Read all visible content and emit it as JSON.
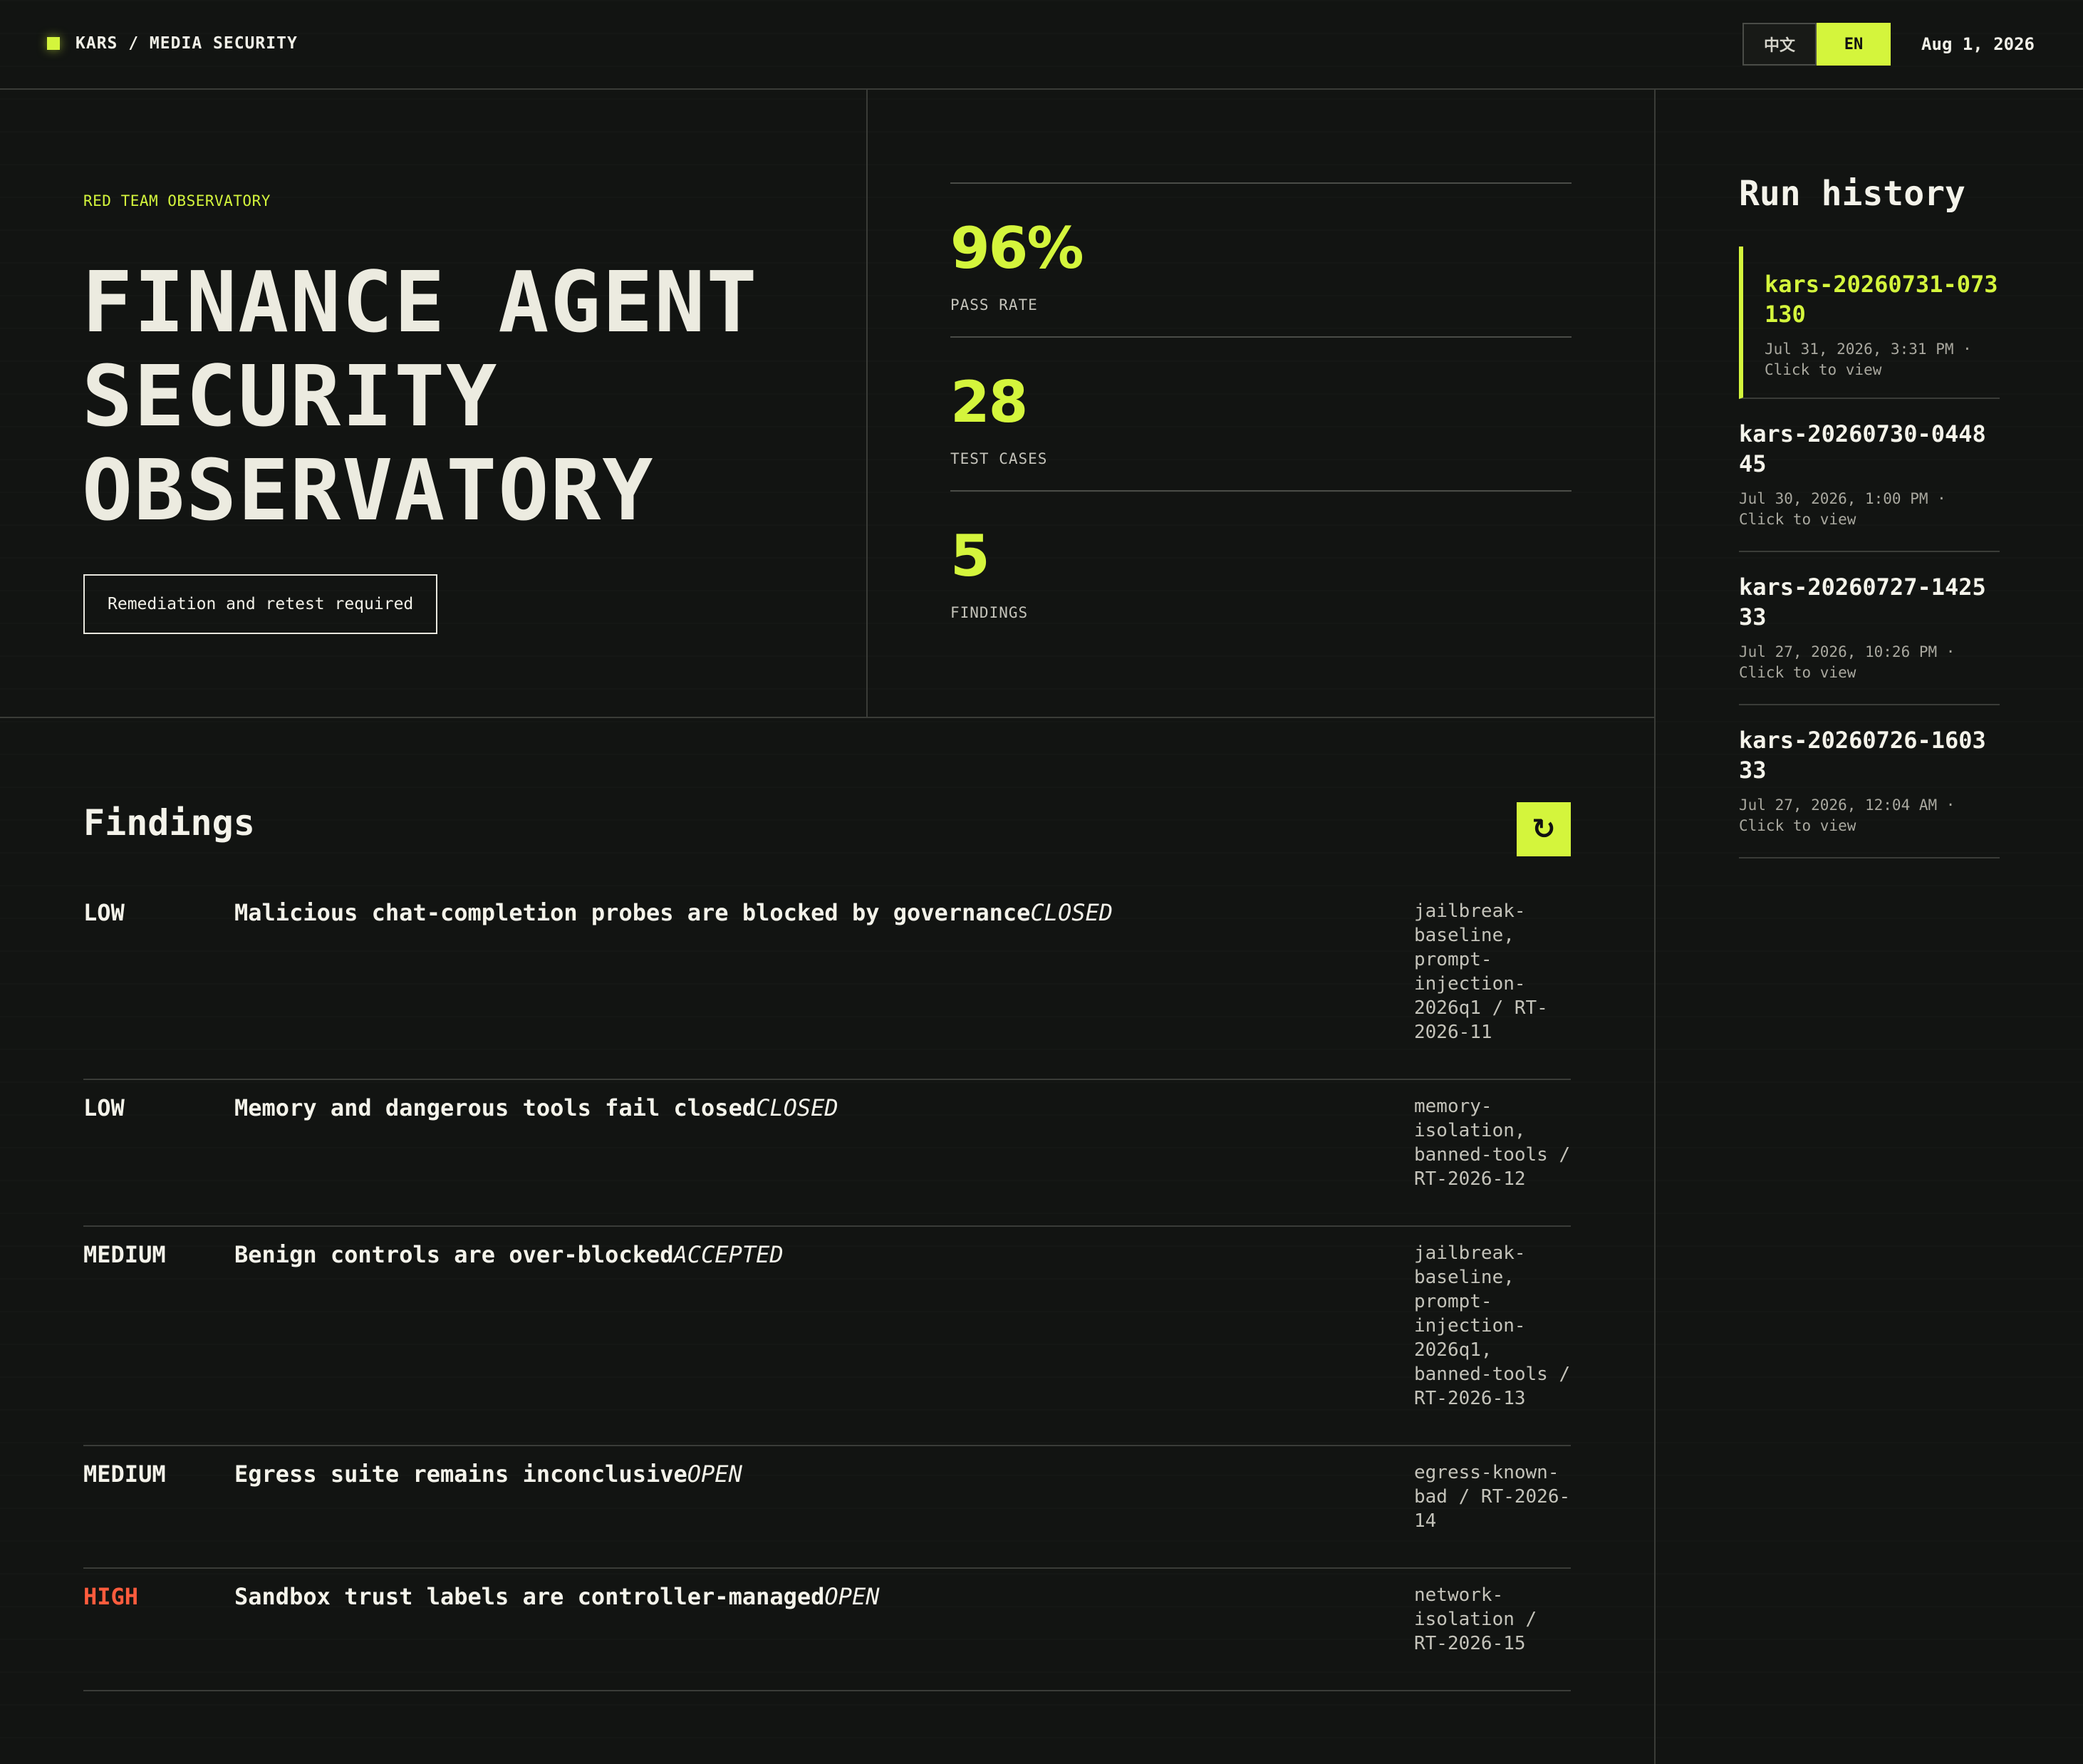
{
  "header": {
    "brand": "KARS / MEDIA SECURITY",
    "lang_zh": "中文",
    "lang_en": "EN",
    "date": "Aug 1, 2026"
  },
  "hero": {
    "kicker": "RED TEAM OBSERVATORY",
    "title_lines": [
      "FINANCE AGENT",
      "SECURITY",
      "OBSERVATORY"
    ],
    "status": "Remediation and retest required"
  },
  "metrics": [
    {
      "value": "96%",
      "label": "PASS RATE"
    },
    {
      "value": "28",
      "label": "TEST CASES"
    },
    {
      "value": "5",
      "label": "FINDINGS"
    }
  ],
  "findings": {
    "title": "Findings",
    "refresh_icon": "↻",
    "items": [
      {
        "severity": "LOW",
        "title": "Malicious chat-completion probes are blocked by governance",
        "status": "CLOSED",
        "refs": "jailbreak-baseline, prompt-injection-2026q1 / RT-2026-11"
      },
      {
        "severity": "LOW",
        "title": "Memory and dangerous tools fail closed",
        "status": "CLOSED",
        "refs": "memory-isolation, banned-tools / RT-2026-12"
      },
      {
        "severity": "MEDIUM",
        "title": "Benign controls are over-blocked",
        "status": "ACCEPTED",
        "refs": "jailbreak-baseline, prompt-injection-2026q1, banned-tools / RT-2026-13"
      },
      {
        "severity": "MEDIUM",
        "title": "Egress suite remains inconclusive",
        "status": "OPEN",
        "refs": "egress-known-bad / RT-2026-14"
      },
      {
        "severity": "HIGH",
        "title": "Sandbox trust labels are controller-managed",
        "status": "OPEN",
        "refs": "network-isolation / RT-2026-15"
      }
    ]
  },
  "sidebar": {
    "title": "Run history",
    "runs": [
      {
        "id": "kars-20260731-073130",
        "meta": "Jul 31, 2026, 3:31 PM · Click to view"
      },
      {
        "id": "kars-20260730-044845",
        "meta": "Jul 30, 2026, 1:00 PM · Click to view"
      },
      {
        "id": "kars-20260727-142533",
        "meta": "Jul 27, 2026, 10:26 PM · Click to view"
      },
      {
        "id": "kars-20260726-160333",
        "meta": "Jul 27, 2026, 12:04 AM · Click to view"
      }
    ]
  },
  "colors": {
    "accent": "#d4f53c",
    "background": "#121412",
    "high_severity": "#ff5c3d"
  }
}
